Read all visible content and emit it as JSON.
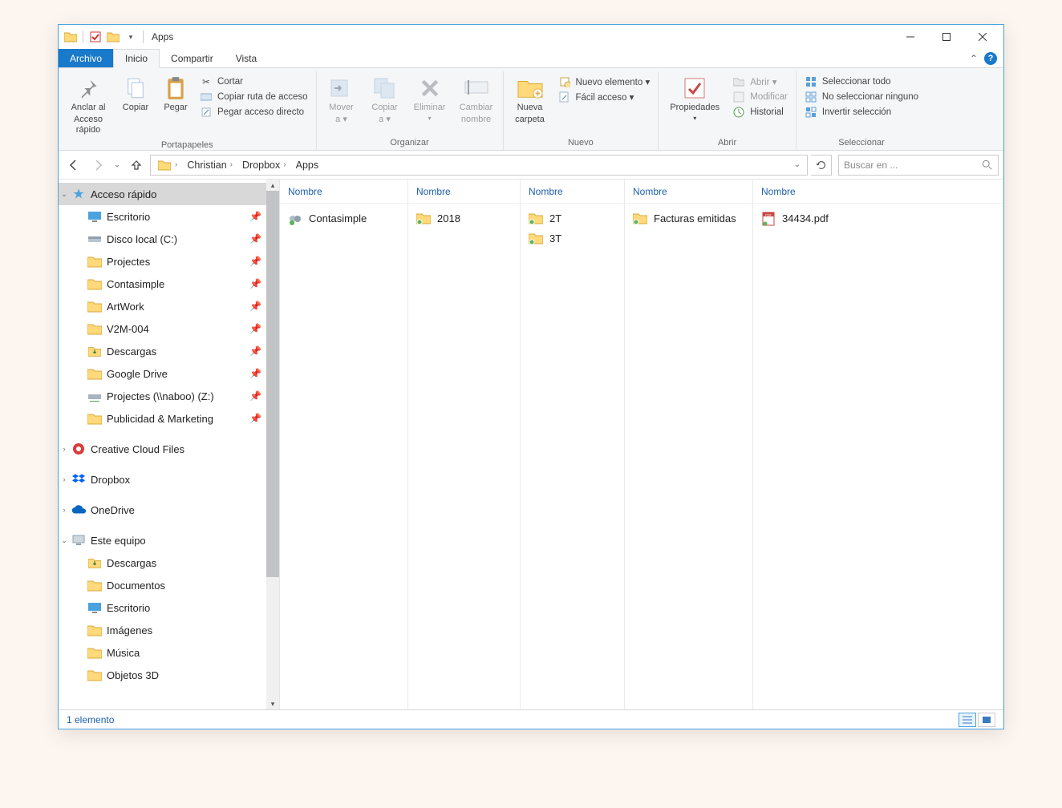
{
  "window": {
    "title": "Apps"
  },
  "menutabs": {
    "file": "Archivo",
    "home": "Inicio",
    "share": "Compartir",
    "view": "Vista"
  },
  "ribbon": {
    "pin": {
      "line1": "Anclar al",
      "line2": "Acceso rápido"
    },
    "copy": "Copiar",
    "paste": "Pegar",
    "cut": "Cortar",
    "copypath": "Copiar ruta de acceso",
    "pastelnk": "Pegar acceso directo",
    "g_clip": "Portapapeles",
    "moveto": {
      "l1": "Mover",
      "l2": "a ▾"
    },
    "copyto": {
      "l1": "Copiar",
      "l2": "a ▾"
    },
    "delete": "Eliminar",
    "rename": {
      "l1": "Cambiar",
      "l2": "nombre"
    },
    "g_org": "Organizar",
    "newfolder": {
      "l1": "Nueva",
      "l2": "carpeta"
    },
    "newitem": "Nuevo elemento ▾",
    "easyaccess": "Fácil acceso ▾",
    "g_new": "Nuevo",
    "props": "Propiedades",
    "open": "Abrir ▾",
    "edit": "Modificar",
    "history": "Historial",
    "g_open": "Abrir",
    "selall": "Seleccionar todo",
    "selnone": "No seleccionar ninguno",
    "selinv": "Invertir selección",
    "g_sel": "Seleccionar"
  },
  "breadcrumbs": [
    "Christian",
    "Dropbox",
    "Apps"
  ],
  "search": {
    "placeholder": "Buscar en ..."
  },
  "sidebar": {
    "quick": "Acceso rápido",
    "pinned": [
      "Escritorio",
      "Disco local (C:)",
      "Projectes",
      "Contasimple",
      "ArtWork",
      "V2M-004",
      "Descargas",
      "Google Drive",
      "Projectes (\\\\naboo) (Z:)",
      "Publicidad & Marketing"
    ],
    "ccf": "Creative Cloud Files",
    "dropbox": "Dropbox",
    "onedrive": "OneDrive",
    "thispc": "Este equipo",
    "pcitems": [
      "Descargas",
      "Documentos",
      "Escritorio",
      "Imágenes",
      "Música",
      "Objetos 3D"
    ]
  },
  "columns": {
    "header": "Nombre",
    "c0": [
      "Contasimple"
    ],
    "c1": [
      "2018"
    ],
    "c2": [
      "2T",
      "3T"
    ],
    "c3": [
      "Facturas emitidas"
    ],
    "c4": [
      "34434.pdf"
    ]
  },
  "status": {
    "text": "1 elemento"
  }
}
